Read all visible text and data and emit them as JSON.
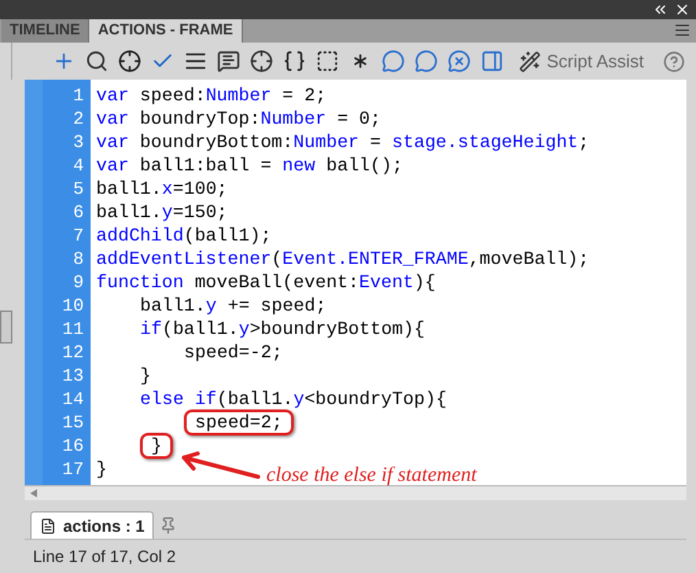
{
  "tabs": [
    {
      "label": "TIMELINE",
      "selected": false
    },
    {
      "label": "ACTIONS - FRAME",
      "selected": true
    }
  ],
  "toolbar": {
    "script_assist": "Script Assist"
  },
  "code": [
    {
      "number": "1",
      "tokens": [
        {
          "text": "var",
          "kind": "keyword"
        },
        {
          "text": " speed:",
          "kind": "plain"
        },
        {
          "text": "Number",
          "kind": "keyword"
        },
        {
          "text": " = 2;",
          "kind": "plain"
        }
      ]
    },
    {
      "number": "2",
      "tokens": [
        {
          "text": "var",
          "kind": "keyword"
        },
        {
          "text": " boundryTop:",
          "kind": "plain"
        },
        {
          "text": "Number",
          "kind": "keyword"
        },
        {
          "text": " = 0;",
          "kind": "plain"
        }
      ]
    },
    {
      "number": "3",
      "tokens": [
        {
          "text": "var",
          "kind": "keyword"
        },
        {
          "text": " boundryBottom:",
          "kind": "plain"
        },
        {
          "text": "Number",
          "kind": "keyword"
        },
        {
          "text": " = ",
          "kind": "plain"
        },
        {
          "text": "stage.stageHeight",
          "kind": "keyword"
        },
        {
          "text": ";",
          "kind": "plain"
        }
      ]
    },
    {
      "number": "4",
      "tokens": [
        {
          "text": "var",
          "kind": "keyword"
        },
        {
          "text": " ball1:ball = ",
          "kind": "plain"
        },
        {
          "text": "new",
          "kind": "keyword"
        },
        {
          "text": " ball();",
          "kind": "plain"
        }
      ]
    },
    {
      "number": "5",
      "tokens": [
        {
          "text": "ball1.",
          "kind": "plain"
        },
        {
          "text": "x",
          "kind": "keyword"
        },
        {
          "text": "=100;",
          "kind": "plain"
        }
      ]
    },
    {
      "number": "6",
      "tokens": [
        {
          "text": "ball1.",
          "kind": "plain"
        },
        {
          "text": "y",
          "kind": "keyword"
        },
        {
          "text": "=150;",
          "kind": "plain"
        }
      ]
    },
    {
      "number": "7",
      "tokens": [
        {
          "text": "addChild",
          "kind": "keyword"
        },
        {
          "text": "(ball1);",
          "kind": "plain"
        }
      ]
    },
    {
      "number": "8",
      "tokens": [
        {
          "text": "addEventListener",
          "kind": "keyword"
        },
        {
          "text": "(",
          "kind": "plain"
        },
        {
          "text": "Event.ENTER_FRAME",
          "kind": "keyword"
        },
        {
          "text": ",moveBall);",
          "kind": "plain"
        }
      ]
    },
    {
      "number": "9",
      "tokens": [
        {
          "text": "function",
          "kind": "keyword"
        },
        {
          "text": " moveBall(event:",
          "kind": "plain"
        },
        {
          "text": "Event",
          "kind": "keyword"
        },
        {
          "text": "){",
          "kind": "plain"
        }
      ],
      "children": [
        {
          "number": "10",
          "tokens": [
            {
              "text": "ball1.",
              "kind": "plain"
            },
            {
              "text": "y",
              "kind": "keyword"
            },
            {
              "text": " += speed;",
              "kind": "plain"
            }
          ]
        },
        {
          "number": "11",
          "tokens": [
            {
              "text": "if",
              "kind": "keyword"
            },
            {
              "text": "(ball1.",
              "kind": "plain"
            },
            {
              "text": "y",
              "kind": "keyword"
            },
            {
              "text": ">boundryBottom){",
              "kind": "plain"
            }
          ],
          "children": [
            {
              "number": "12",
              "tokens": [
                {
                  "text": "speed=-2;",
                  "kind": "plain"
                }
              ]
            }
          ]
        },
        {
          "number": "13",
          "tokens": [
            {
              "text": "}",
              "kind": "plain"
            }
          ]
        },
        {
          "number": "14",
          "tokens": [
            {
              "text": "else if",
              "kind": "keyword"
            },
            {
              "text": "(ball1.",
              "kind": "plain"
            },
            {
              "text": "y",
              "kind": "keyword"
            },
            {
              "text": "<boundryTop){",
              "kind": "plain"
            }
          ],
          "children": [
            {
              "number": "15",
              "tokens": [
                {
                  "text": "speed=2;",
                  "kind": "plain",
                  "circled": true
                }
              ]
            }
          ]
        },
        {
          "number": "16",
          "tokens": [
            {
              "text": "}",
              "kind": "plain",
              "circled": true
            }
          ]
        }
      ]
    },
    {
      "number": "17",
      "tokens": [
        {
          "text": "}",
          "kind": "plain"
        }
      ],
      "annotation": "close the else if statement"
    }
  ],
  "document_tab": {
    "label": "actions : 1"
  },
  "status_bar": "Line 17 of 17, Col 2"
}
